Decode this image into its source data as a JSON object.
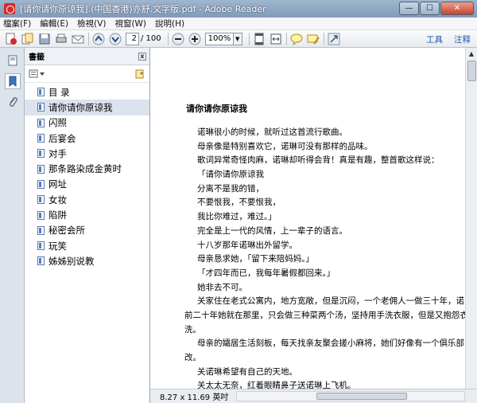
{
  "window": {
    "title": "[请你请你原谅我].(中国香港)亦舒.文字版.pdf - Adobe Reader",
    "min_label": "—",
    "max_label": "☐",
    "close_label": "✕"
  },
  "menu": [
    "檔案(F)",
    "編輯(E)",
    "檢視(V)",
    "視窗(W)",
    "說明(H)"
  ],
  "toolbar": {
    "page_current": "2",
    "page_total": "/ 100",
    "zoom": "100%",
    "tools_label": "工具",
    "comment_label": "注释"
  },
  "bookmarks": {
    "title": "書籤",
    "close_label": "x",
    "items": [
      "目 录",
      "请你请你原谅我",
      "闪照",
      "后宴会",
      "对手",
      "那条路染成金黄时",
      "网址",
      "女妆",
      "陷阱",
      "秘密会所",
      "玩笑",
      "姊姊别说教"
    ],
    "selected_index": 1
  },
  "document": {
    "title": "请你请你原谅我",
    "lines": [
      "诺琳很小的时候，就听过这首流行歌曲。",
      "母亲像是特别喜欢它，诺琳可没有那样的品味。",
      "歌词异常奇怪肉麻，诺琳却听得会背！真是有趣，整首歌这样说：",
      "「请你请你原谅我",
      "分离不是我的错，",
      "不要恨我，不要恨我，",
      "我比你难过，难过。」",
      "完全是上一代的风情，上一辈子的语言。",
      "十八岁那年诺琳出外留学。",
      "母亲恳求她，「留下来陪妈妈。」",
      "「才四年而已，我每年暑假都回来。」",
      "她非去不可。",
      "关家住在老式公寓内，地方宽敞，但是沉闷，一个老佣人一做三十年，诺",
      "前二十年她就在那里，只会做三种菜两个汤，坚持用手洗衣服，但是又抱怨衣",
      "洗。",
      "母亲的孀居生活刻板，每天找亲友聚会搓小麻将，她们好像有一个俱乐部，",
      "改。",
      "关诺琳希望有自己的天地。",
      "关太太无奈，红着眼睛鼻子送诺琳上飞机。"
    ],
    "page_size": "8.27 x 11.69 英吋"
  },
  "colors": {
    "titlebar": "#8aa5c2",
    "accent": "#1d5aa5",
    "selected_bookmark": "#dbe3ee"
  }
}
